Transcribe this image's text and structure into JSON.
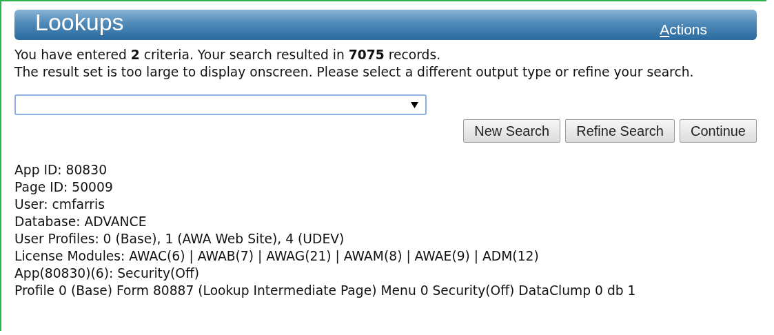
{
  "header": {
    "title": "Lookups",
    "actions_link": "Actions"
  },
  "message": [
    "You have entered **2** criteria. Your search resulted in **7075** records.",
    "The result set is too large to display onscreen. Please select a different output type or refine your search."
  ],
  "buttons": [
    {
      "label": "New Search"
    },
    {
      "label": "Refine Search"
    },
    {
      "label": "Continue"
    }
  ],
  "info_lines": [
    "App ID: 80830",
    "Page ID: 50009",
    "User: cmfarris",
    "Database: ADVANCE",
    "User Profiles: 0 (Base), 1 (AWA Web Site), 4 (UDEV)",
    "License Modules: AWAC(6) | AWAB(7) | AWAG(21) | AWAM(8) | AWAE(9) | ADM(12)",
    "App(80830)(6): Security(Off)",
    "Profile 0 (Base) Form 80887 (Lookup Intermediate Page) Menu 0 Security(Off) DataClump 0 db 1"
  ]
}
